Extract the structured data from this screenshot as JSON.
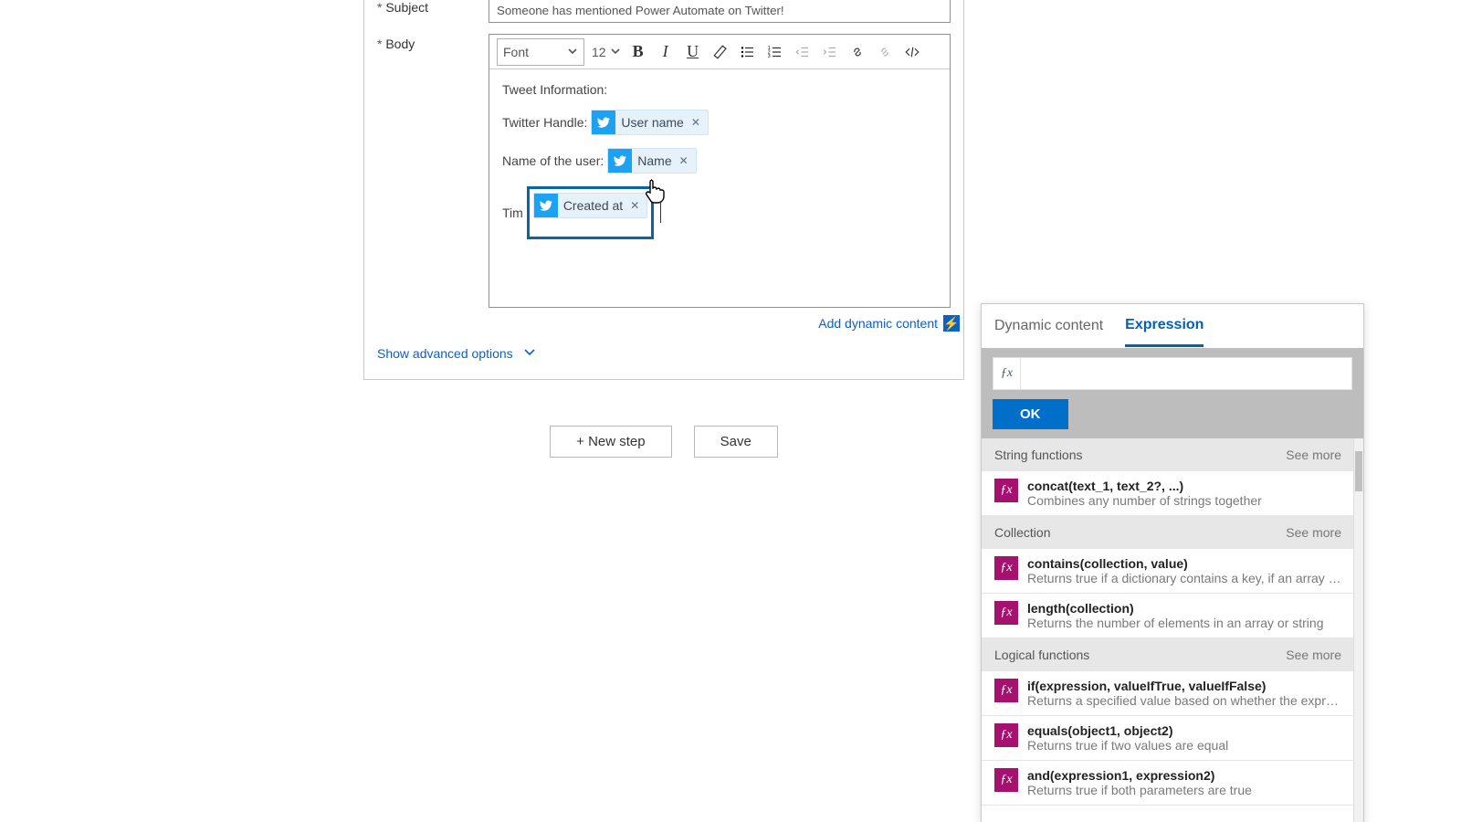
{
  "subject": {
    "label": "Subject",
    "value": "Someone has mentioned Power Automate on Twitter!"
  },
  "body_label": "Body",
  "toolbar": {
    "font": "Font",
    "size": "12"
  },
  "body": {
    "line1": "Tweet Information:",
    "line2_label": "Twitter Handle:",
    "line3_label": "Name of the user:",
    "line4_label": "Tim",
    "tokens": {
      "username": "User name",
      "name": "Name",
      "createdat": "Created at"
    }
  },
  "links": {
    "add_dynamic": "Add dynamic content",
    "show_advanced": "Show advanced options"
  },
  "buttons": {
    "new_step": "+ New step",
    "save": "Save",
    "ok": "OK"
  },
  "panel": {
    "tab_dynamic": "Dynamic content",
    "tab_expression": "Expression",
    "see_more": "See more",
    "categories": {
      "string": "String functions",
      "collection": "Collection",
      "logical": "Logical functions"
    },
    "funcs": {
      "concat_sig": "concat(text_1, text_2?, ...)",
      "concat_desc": "Combines any number of strings together",
      "contains_sig": "contains(collection, value)",
      "contains_desc": "Returns true if a dictionary contains a key, if an array cont...",
      "length_sig": "length(collection)",
      "length_desc": "Returns the number of elements in an array or string",
      "if_sig": "if(expression, valueIfTrue, valueIfFalse)",
      "if_desc": "Returns a specified value based on whether the expressio...",
      "equals_sig": "equals(object1, object2)",
      "equals_desc": "Returns true if two values are equal",
      "and_sig": "and(expression1, expression2)",
      "and_desc": "Returns true if both parameters are true"
    }
  }
}
